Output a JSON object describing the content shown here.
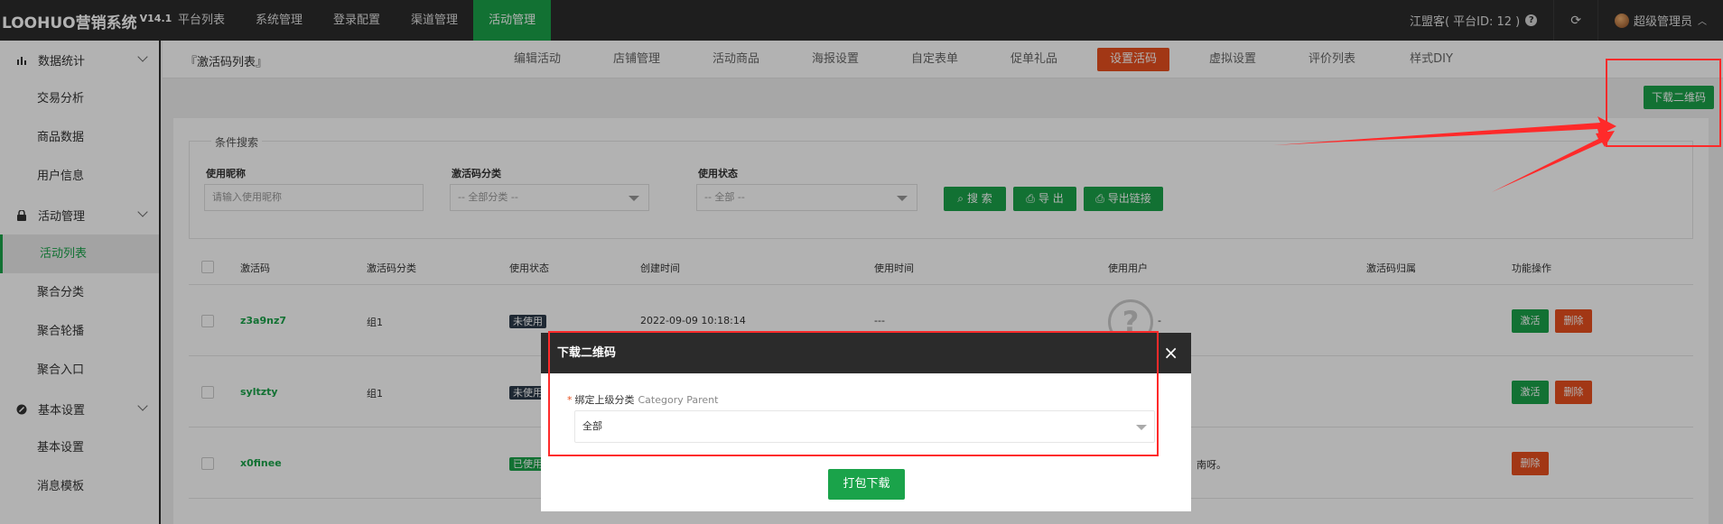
{
  "app": {
    "logo": "LOOHUO营销系统",
    "version": "V14.1"
  },
  "topnav": [
    "平台列表",
    "系统管理",
    "登录配置",
    "渠道管理",
    "活动管理"
  ],
  "topnav_active": 4,
  "topright": {
    "merchant": "江盟客( 平台ID: 12 )",
    "help_icon": "question-circle-icon",
    "refresh_icon": "refresh-icon",
    "user": "超级管理员"
  },
  "sidebar": {
    "groups": [
      {
        "label": "数据统计",
        "icon": "bar-chart-icon",
        "items": [
          "交易分析",
          "商品数据",
          "用户信息"
        ]
      },
      {
        "label": "活动管理",
        "icon": "lock-icon",
        "items": [
          "活动列表",
          "聚合分类",
          "聚合轮播",
          "聚合入口"
        ]
      },
      {
        "label": "基本设置",
        "icon": "settings-icon",
        "items": [
          "基本设置",
          "消息模板"
        ]
      }
    ],
    "active_item": "活动列表"
  },
  "breadcrumb": "『激活码列表』",
  "subtabs": [
    "编辑活动",
    "店铺管理",
    "活动商品",
    "海报设置",
    "自定表单",
    "促单礼品",
    "设置活码",
    "虚拟设置",
    "评价列表",
    "样式DIY"
  ],
  "subtab_active": 6,
  "download_qr_label": "下载二维码",
  "search": {
    "legend": "条件搜索",
    "nickname_label": "使用昵称",
    "nickname_placeholder": "请输入使用昵称",
    "category_label": "激活码分类",
    "category_value": "-- 全部分类 --",
    "status_label": "使用状态",
    "status_value": "-- 全部 --",
    "search_btn": "搜 索",
    "export_btn": "导 出",
    "export_link_btn": "导出链接"
  },
  "table": {
    "headers": [
      "激活码",
      "激活码分类",
      "使用状态",
      "创建时间",
      "使用时间",
      "使用用户",
      "激活码归属",
      "功能操作"
    ],
    "rows": [
      {
        "code": "z3a9nz7",
        "category": "组1",
        "status": "未使用",
        "created": "2022-09-09 10:18:14",
        "used": "---",
        "user": "-",
        "activate": "激活",
        "delete": "删除"
      },
      {
        "code": "syltzty",
        "category": "组1",
        "status": "未使用",
        "activate": "激活",
        "delete": "删除"
      },
      {
        "code": "x0finee",
        "status": "已使用",
        "user_tail": "南呀。",
        "delete": "删除"
      }
    ]
  },
  "modal": {
    "title": "下载二维码",
    "close": "×",
    "field_label": "绑定上级分类",
    "field_label_en": "Category Parent",
    "required_mark": "*",
    "select_value": "全部",
    "submit": "打包下载"
  },
  "colors": {
    "green": "#1aa34a",
    "orange": "#e8501f",
    "dark": "#2b2b2b",
    "annotation": "#ff2a2a"
  }
}
